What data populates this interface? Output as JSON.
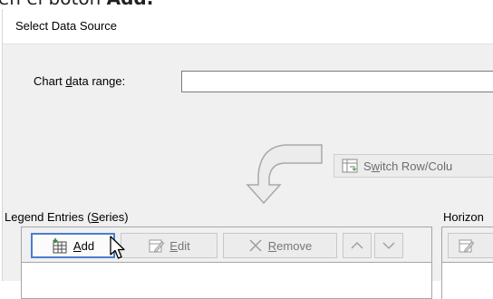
{
  "caption": {
    "prefix": "en el botón ",
    "bold": "Add."
  },
  "dialog": {
    "title": "Select Data Source",
    "chart_data_range_label_pre": "Chart ",
    "chart_data_range_label_ul": "d",
    "chart_data_range_label_post": "ata range:",
    "chart_data_range_value": "",
    "switch_label_pre": "S",
    "switch_label_ul": "w",
    "switch_label_post": "itch Row/Colu",
    "legend_label_pre": "Legend Entries (",
    "legend_label_ul": "S",
    "legend_label_post": "eries)",
    "horiz_label": "Horizon",
    "buttons": {
      "add_ul": "A",
      "add_post": "dd",
      "edit_ul": "E",
      "edit_post": "dit",
      "remove_ul": "R",
      "remove_post": "emove"
    }
  },
  "colors": {
    "focus_border": "#4a7ecb",
    "disabled_text": "#6d6d6d",
    "dialog_bg": "#f0f0f0"
  },
  "icons": [
    "add-series-icon",
    "edit-series-icon",
    "remove-x-icon",
    "move-up-icon",
    "move-down-icon",
    "switch-row-column-icon",
    "curved-arrow-icon",
    "mouse-pointer-icon"
  ]
}
